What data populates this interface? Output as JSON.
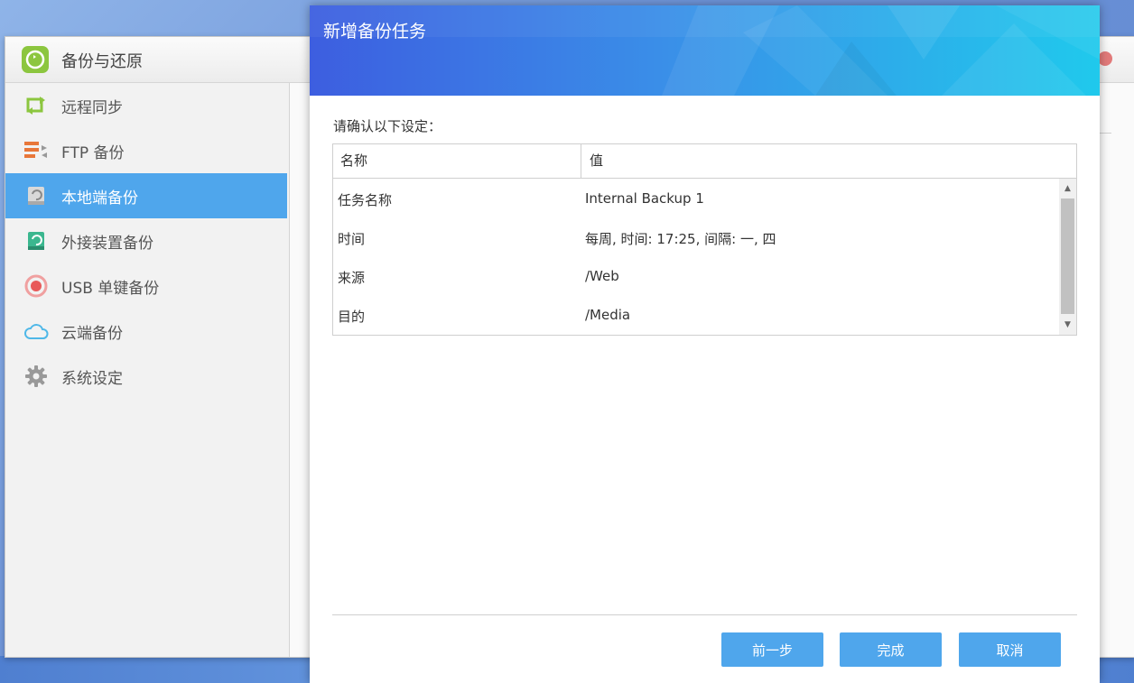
{
  "app": {
    "title": "备份与还原"
  },
  "sidebar": {
    "items": [
      {
        "label": "远程同步",
        "icon": "sync-icon",
        "active": false
      },
      {
        "label": "FTP 备份",
        "icon": "ftp-icon",
        "active": false
      },
      {
        "label": "本地端备份",
        "icon": "local-drive-icon",
        "active": true
      },
      {
        "label": "外接装置备份",
        "icon": "external-drive-icon",
        "active": false
      },
      {
        "label": "USB 单键备份",
        "icon": "usb-button-icon",
        "active": false
      },
      {
        "label": "云端备份",
        "icon": "cloud-icon",
        "active": false
      },
      {
        "label": "系统设定",
        "icon": "gear-icon",
        "active": false
      }
    ]
  },
  "dialog": {
    "title": "新增备份任务",
    "prompt": "请确认以下设定：",
    "table": {
      "headers": {
        "name": "名称",
        "value": "值"
      },
      "rows": [
        {
          "name": "任务名称",
          "value": "Internal Backup 1"
        },
        {
          "name": "时间",
          "value": "每周, 时间: 17:25, 间隔: 一, 四"
        },
        {
          "name": "来源",
          "value": "/Web"
        },
        {
          "name": "目的",
          "value": "/Media"
        }
      ]
    },
    "buttons": {
      "prev": "前一步",
      "finish": "完成",
      "cancel": "取消"
    }
  },
  "colors": {
    "accent": "#4fa6ec",
    "header_start": "#3d5ee0",
    "header_end": "#20c9ec",
    "app_icon": "#8cc63f"
  }
}
